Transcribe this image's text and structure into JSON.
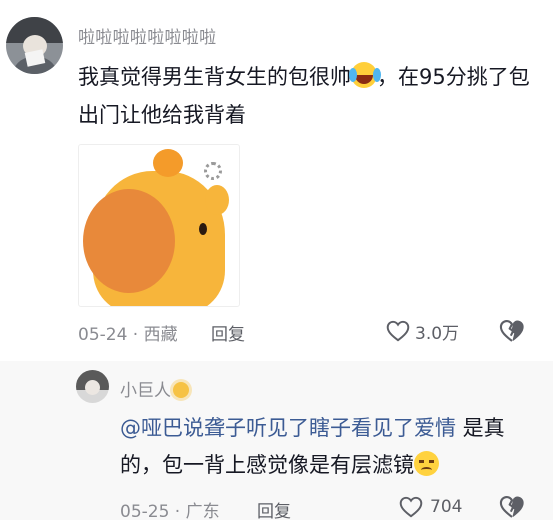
{
  "main_comment": {
    "username": "啦啦啦啦啦啦啦啦",
    "text_part1": "我真觉得男生背女生的包很帅",
    "emoji_1": "crying-laughing-emoji",
    "text_part2": "，在95分挑了包出门让他给我背着",
    "sticker": "cartoon-cow-sticker",
    "date": "05-24",
    "location": "西藏",
    "date_location_sep": " · ",
    "reply_label": "回复",
    "likes": "3.0万",
    "dislike_icon": "broken-heart-icon"
  },
  "reply": {
    "username": "小巨人",
    "badge_icon": "sun-icon",
    "mention": "@哑巴说聋子听见了瞎子看见了爱情",
    "text": " 是真的，包一背上感觉像是有层滤镜",
    "emoji": "sad-face-emoji",
    "date": "05-25",
    "location": "广东",
    "date_location_sep": " · ",
    "reply_label": "回复",
    "likes": "704",
    "dislike_icon": "broken-heart-icon"
  },
  "colors": {
    "mention": "#3c5b94",
    "secondary_text": "#8a8b91",
    "reply_background": "#f8f8f8"
  }
}
